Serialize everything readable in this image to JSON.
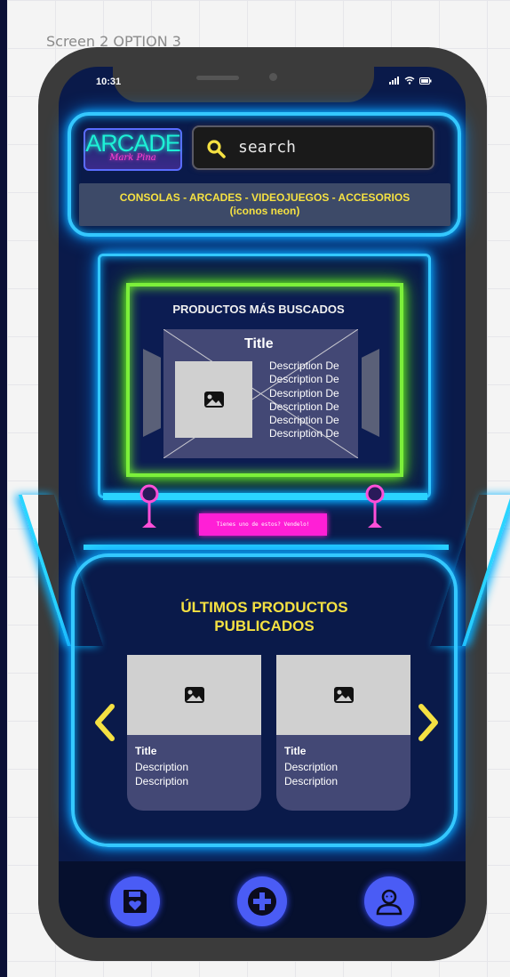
{
  "frame": {
    "label": "Screen 2 OPTION 3"
  },
  "status_bar": {
    "time": "10:31",
    "icons": [
      "signal-icon",
      "wifi-icon",
      "battery-icon"
    ]
  },
  "header": {
    "logo_main": "ARCADE",
    "logo_sub": "Mark Pina",
    "search": {
      "placeholder": "search",
      "icon": "search-icon"
    }
  },
  "categories": {
    "line1": "CONSOLAS - ARCADES - VIDEOJUEGOS - ACCESORIOS",
    "line2": "(iconos neon)"
  },
  "most_searched": {
    "title": "PRODUCTOS MÁS BUSCADOS",
    "card": {
      "title": "Title",
      "description": [
        "Description De",
        "Description De",
        "Description De",
        "Description De",
        "Description De",
        "Description De"
      ]
    }
  },
  "cta": {
    "label": "Tienes uno de estos? Vendelo!"
  },
  "latest": {
    "title_line1": "ÚLTIMOS PRODUCTOS",
    "title_line2": "PUBLICADOS",
    "products": [
      {
        "title": "Title",
        "description": [
          "Description",
          "Description"
        ]
      },
      {
        "title": "Title",
        "description": [
          "Description",
          "Description"
        ]
      }
    ]
  },
  "bottom_nav": {
    "items": [
      {
        "icon": "saved-heart-icon"
      },
      {
        "icon": "plus-icon"
      },
      {
        "icon": "user-profile-icon"
      }
    ]
  },
  "colors": {
    "neon_blue": "#34c8ff",
    "neon_green": "#7cf03a",
    "neon_pink": "#ff1fd6",
    "accent_yellow": "#f5e142",
    "nav_button": "#4a5cf5"
  }
}
